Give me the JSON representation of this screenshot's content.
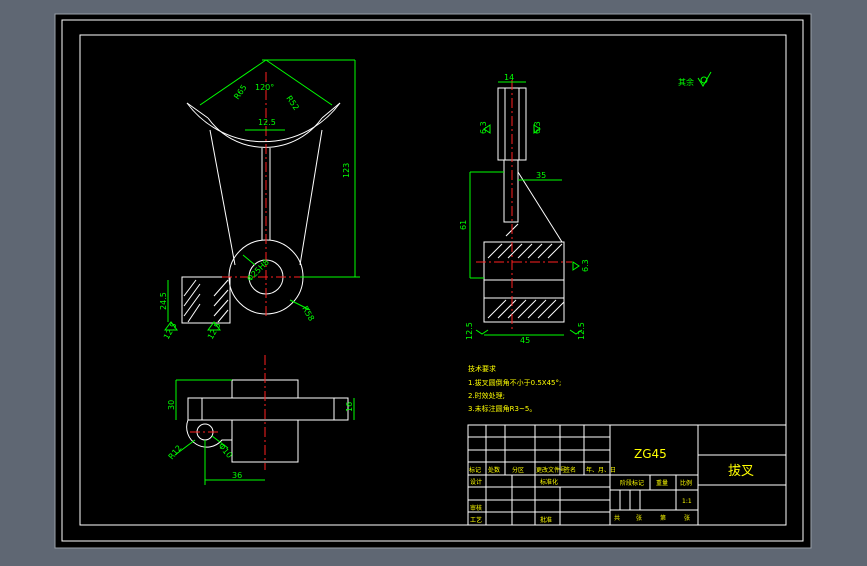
{
  "colors": {
    "window_bg": "#5f6773",
    "canvas_bg": "#000000",
    "line_white": "#ffffff",
    "dimension_green": "#00ff00",
    "centerline_red": "#ff2020",
    "hatch_white": "#ffffff"
  },
  "drawing": {
    "top_view": {
      "angle_dim": "120°",
      "width_dim_left": "R65",
      "width_dim_right": "R52",
      "surface_finish": "12.5",
      "height_dim": "123",
      "hole_dim": "Φ25H8",
      "boss_dim": "R58",
      "left_section_dim": "24.5",
      "left_finish_1": "12.5",
      "left_finish_2": "12.5"
    },
    "side_view": {
      "top_width_dim": "14",
      "left_finish": "6.3",
      "right_finish": "6.3",
      "height_dim": "61",
      "slope_dim": "35",
      "right_finish_2": "6.3",
      "bottom_left_finish": "12.5",
      "bottom_dim": "45",
      "bottom_right_finish": "12.5"
    },
    "bottom_view": {
      "left_height_dim": "30",
      "right_height_dim": "16",
      "radius_dim": "R12",
      "hole_dim": "Φ10",
      "bottom_dim": "36"
    },
    "roughness_note": "其余",
    "tech_requirements": {
      "title": "技术要求",
      "lines": [
        "1.拔叉圆倒角不小于0.5X45°;",
        "2.时效处理;",
        "3.未标注圆角R3~5。"
      ]
    },
    "title_block": {
      "material": "ZG45",
      "part_name": "拔叉",
      "header_labels": [
        "标记",
        "处数",
        "分区",
        "更改文件号",
        "签名",
        "年、月、日"
      ],
      "design_label": "设计",
      "standard_label": "标准化",
      "review_label": "审核",
      "process_label": "工艺",
      "approve_label": "批准",
      "stage_label": "阶段标记",
      "weight_label": "重量",
      "scale_label": "比例",
      "scale_value": "1:1",
      "sheet_labels": [
        "共",
        "张",
        "第",
        "张"
      ]
    }
  }
}
